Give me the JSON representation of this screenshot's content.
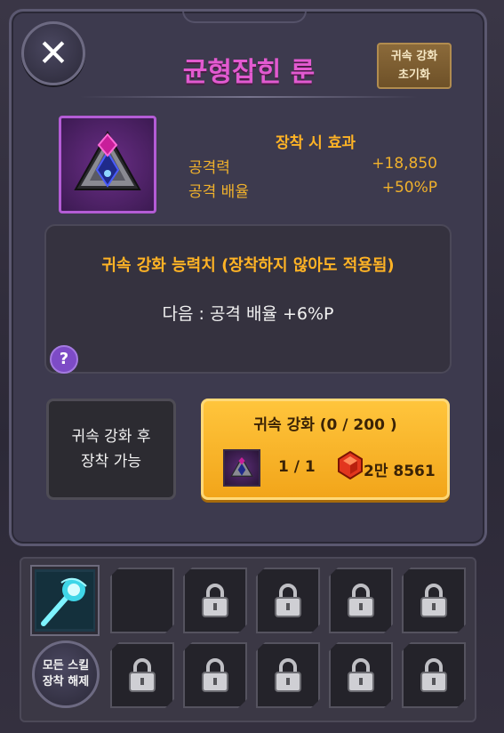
{
  "header": {
    "title": "균형잡힌 룬",
    "close_icon": "close-icon",
    "reset_button": {
      "line1": "귀속 강화",
      "line2": "초기화"
    }
  },
  "item": {
    "icon": "balanced-rune-icon",
    "effect_title": "장착 시 효과",
    "stats": [
      {
        "label": "공격력",
        "value": "+18,850"
      },
      {
        "label": "공격 배율",
        "value": "+50%P"
      }
    ]
  },
  "ability": {
    "title": "귀속 강화 능력치 (장착하지 않아도 적용됨)",
    "next": "다음 : 공격 배율 +6%P",
    "help_label": "?"
  },
  "actions": {
    "equip_disabled": {
      "line1": "귀속 강화 후",
      "line2": "장착 가능"
    },
    "upgrade": {
      "title": "귀속 강화 (0 / 200 )",
      "material_count": "1 / 1",
      "cost": "2만 8561",
      "cost_icon": "red-gem-icon"
    }
  },
  "skills": {
    "equipped_icon": "energy-orb-skill-icon",
    "unequip_all": {
      "line1": "모든 스킬",
      "line2": "장착 해제"
    },
    "slot_icon": "lock-icon"
  },
  "colors": {
    "title": "#e25ad0",
    "accent_gold": "#ffb325",
    "upgrade_button": "#ffc53c",
    "panel": "#3d3a4e"
  }
}
